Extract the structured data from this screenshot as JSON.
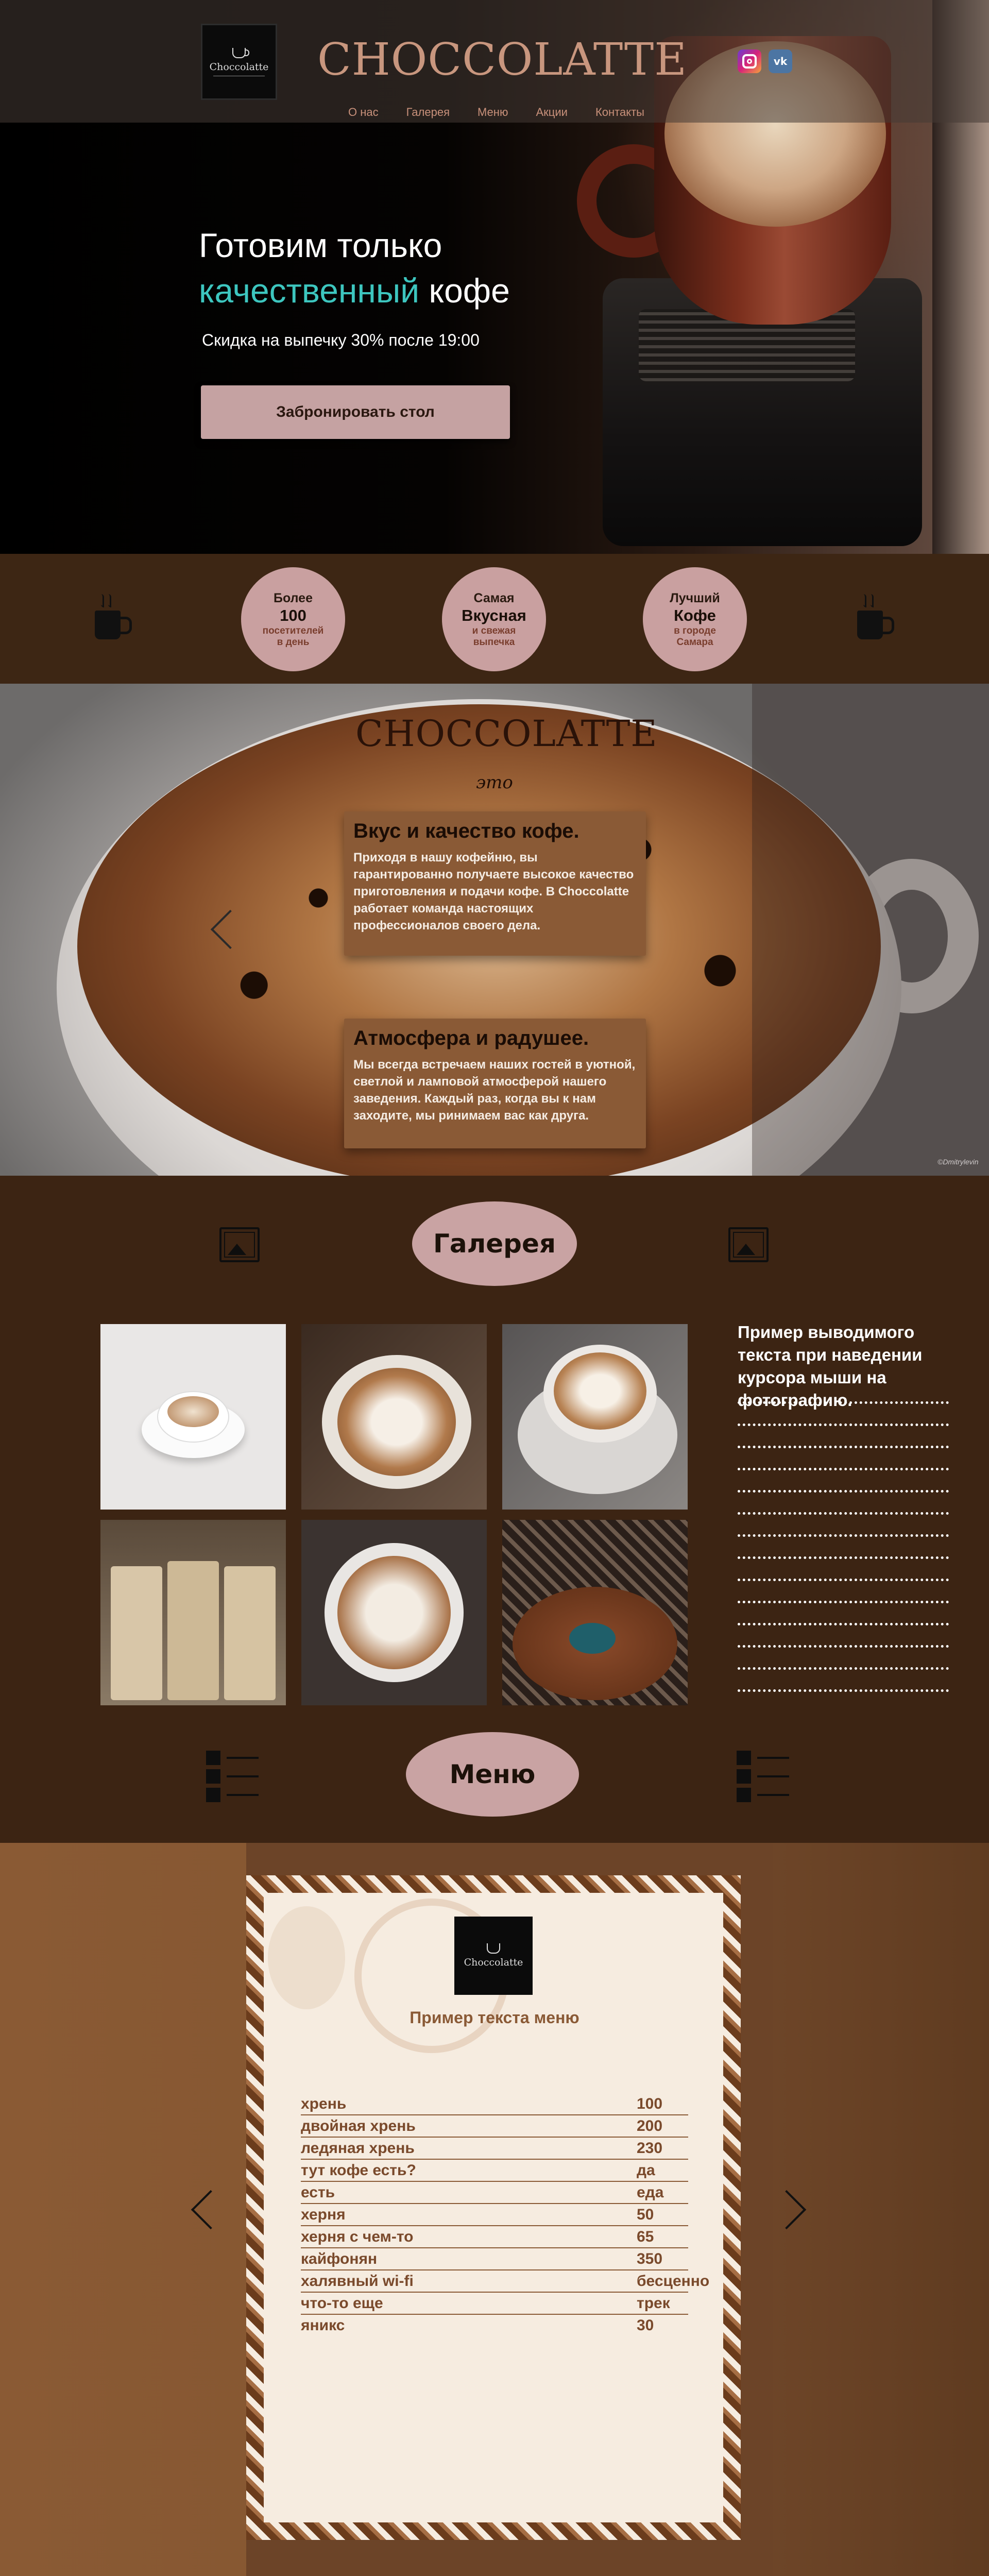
{
  "header": {
    "logo_text": "Choccolatte",
    "brand": "CHOCCOLATTE",
    "social": [
      "instagram",
      "vk"
    ],
    "vk_label": "vk",
    "nav": [
      "О нас",
      "Галерея",
      "Меню",
      "Акции",
      "Контакты"
    ]
  },
  "hero": {
    "title_line1": "Готовим только",
    "title_accent": "качественный",
    "title_rest": "кофе",
    "subtitle": "Скидка на выпечку 30% после 19:00",
    "button": "Забронировать стол",
    "accent_color": "#3dc6bf"
  },
  "features": [
    {
      "top": "Более",
      "big": "100",
      "small": "посетителей в день"
    },
    {
      "top": "Самая",
      "big": "Вкусная",
      "small": "и свежая выпечка"
    },
    {
      "top": "Лучший",
      "big": "Кофе",
      "small": "в городе Самара"
    }
  ],
  "about": {
    "brand": "CHOCCOLATTE",
    "tagline": "это",
    "card1_title": "Вкус и качество кофе.",
    "card1_text": "Приходя в нашу кофейню, вы гарантированно получаете высокое качество приготовления и подачи кофе. В Choccolatte работает команда настоящих профессионалов своего дела.",
    "card2_title": "Атмосфера и радушее.",
    "card2_text": "Мы всегда встречаем наших гостей в уютной, светлой и ламповой атмосферой нашего заведения. Каждый раз, когда вы к нам заходите, мы ринимаем вас как друга.",
    "credit": "©Dmitrylevin"
  },
  "gallery": {
    "title": "Галерея",
    "hover_text": "Пример выводимого текста при наведении курсора мыши на фотографию.",
    "photos": [
      "latte-cup",
      "latte-art-bear",
      "latte-bear-saucer",
      "coffee-bags",
      "latte-art-minion",
      "cafe-table"
    ]
  },
  "menu": {
    "title": "Меню",
    "card_logo": "Choccolatte",
    "card_title": "Пример текста меню",
    "items": [
      {
        "name": "хрень",
        "price": "100"
      },
      {
        "name": "двойная хрень",
        "price": "200"
      },
      {
        "name": "ледяная хрень",
        "price": "230"
      },
      {
        "name": "тут кофе есть?",
        "price": "да"
      },
      {
        "name": "есть",
        "price": "еда"
      },
      {
        "name": "херня",
        "price": "50"
      },
      {
        "name": "херня с чем-то",
        "price": "65"
      },
      {
        "name": "кайфонян",
        "price": "350"
      },
      {
        "name": "халявный wi-fi",
        "price": "бесценно"
      },
      {
        "name": "что-то еще",
        "price": "трек"
      },
      {
        "name": "яникс",
        "price": "30"
      }
    ]
  }
}
